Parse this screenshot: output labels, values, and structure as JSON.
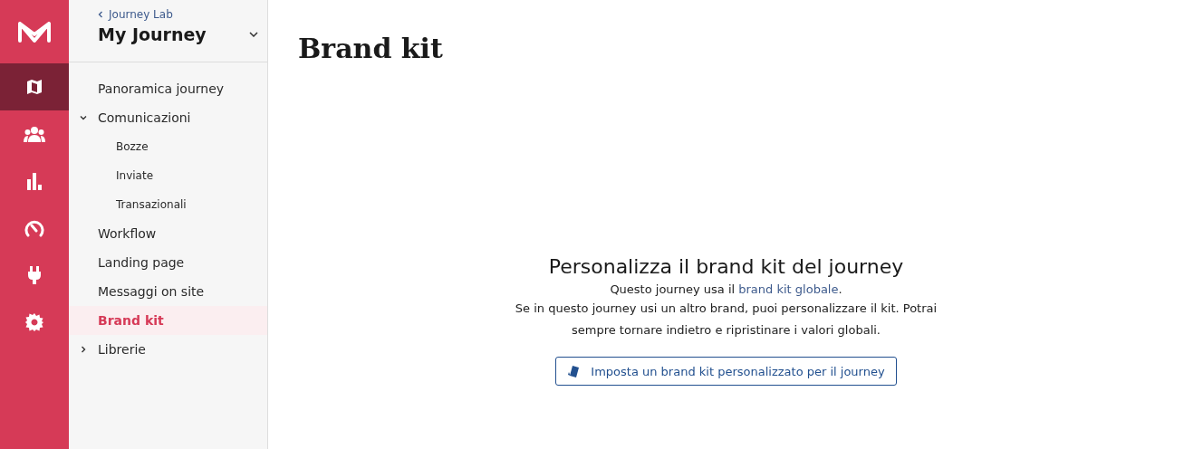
{
  "rail": {
    "items": [
      {
        "kind": "map",
        "selected": true
      },
      {
        "kind": "people",
        "selected": false
      },
      {
        "kind": "chart",
        "selected": false
      },
      {
        "kind": "gauge",
        "selected": false
      },
      {
        "kind": "plug",
        "selected": false
      },
      {
        "kind": "gear",
        "selected": false
      }
    ]
  },
  "sidebar": {
    "back_link": "Journey Lab",
    "title": "My Journey",
    "items": [
      {
        "label": "Panoramica journey",
        "selected": false
      },
      {
        "label": "Comunicazioni",
        "selected": false,
        "expanded": true,
        "children": [
          {
            "label": "Bozze",
            "selected": false
          },
          {
            "label": "Inviate",
            "selected": false
          },
          {
            "label": "Transazionali",
            "selected": false
          }
        ]
      },
      {
        "label": "Workflow",
        "selected": false
      },
      {
        "label": "Landing page",
        "selected": false
      },
      {
        "label": "Messaggi on site",
        "selected": false
      },
      {
        "label": "Brand kit",
        "selected": true
      },
      {
        "label": "Librerie",
        "selected": false,
        "expanded": false
      }
    ]
  },
  "page": {
    "title": "Brand kit",
    "empty_state": {
      "heading": "Personalizza il brand kit del journey",
      "intro_before": "Questo journey usa il ",
      "intro_link": "brand kit globale",
      "intro_after": ".",
      "description": "Se in questo journey usi un altro brand, puoi personalizzare il kit. Potrai sempre tornare indietro e ripristinare i valori globali.",
      "button": "Imposta un brand kit personalizzato per il journey"
    }
  }
}
